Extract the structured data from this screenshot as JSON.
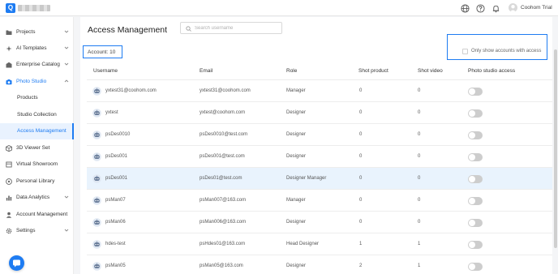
{
  "topbar": {
    "logo_letter": "Q",
    "user_name": "Coohom Trial",
    "icons": [
      "globe-icon",
      "help-icon",
      "bell-icon",
      "avatar"
    ]
  },
  "sidebar": {
    "items": [
      {
        "label": "Projects",
        "icon": "folder-icon",
        "chevron": true
      },
      {
        "label": "AI Templates",
        "icon": "sparkle-icon",
        "chevron": true
      },
      {
        "label": "Enterprise Catalog",
        "icon": "catalog-icon",
        "chevron": true
      },
      {
        "label": "Photo Studio",
        "icon": "camera-icon",
        "chevron": true,
        "expanded": true
      },
      {
        "label": "Products",
        "sub": true
      },
      {
        "label": "Studio Collection",
        "sub": true
      },
      {
        "label": "Access Management",
        "sub": true,
        "active": true
      },
      {
        "label": "3D Viewer Set",
        "icon": "cube-icon"
      },
      {
        "label": "Virtual Showroom",
        "icon": "showroom-icon"
      },
      {
        "label": "Personal Library",
        "icon": "library-icon"
      },
      {
        "label": "Data Analytics",
        "icon": "chart-icon",
        "chevron": true
      },
      {
        "label": "Account Management",
        "icon": "user-icon"
      },
      {
        "label": "Settings",
        "icon": "gear-icon",
        "chevron": true
      }
    ]
  },
  "main": {
    "title": "Access Management",
    "search_placeholder": "Search username",
    "account_count": "Account: 10",
    "filter_label": "Only show accounts with access",
    "columns": [
      "Username",
      "Email",
      "Role",
      "Shot product",
      "Shot video",
      "Photo studio access"
    ],
    "rows": [
      {
        "username": "yxtest31@coohom.com",
        "email": "yxtest31@coohom.com",
        "role": "Manager",
        "shot_product": "0",
        "shot_video": "0",
        "access": false
      },
      {
        "username": "yxtest",
        "email": "yxtest@coohom.com",
        "role": "Designer",
        "shot_product": "0",
        "shot_video": "0",
        "access": false
      },
      {
        "username": "psDes0010",
        "email": "psDes0010@test.com",
        "role": "Designer",
        "shot_product": "0",
        "shot_video": "0",
        "access": false
      },
      {
        "username": "psDes001",
        "email": "psDes001@test.com",
        "role": "Designer",
        "shot_product": "0",
        "shot_video": "0",
        "access": false
      },
      {
        "username": "psDes001",
        "email": "psDes01@test.com",
        "role": "Designer Manager",
        "shot_product": "0",
        "shot_video": "0",
        "access": false,
        "highlighted": true
      },
      {
        "username": "psMan07",
        "email": "psMan007@163.com",
        "role": "Manager",
        "shot_product": "0",
        "shot_video": "0",
        "access": false
      },
      {
        "username": "psMan06",
        "email": "psMan006@163.com",
        "role": "Designer",
        "shot_product": "0",
        "shot_video": "0",
        "access": false
      },
      {
        "username": "hdes-test",
        "email": "psHdes01@163.com",
        "role": "Head Designer",
        "shot_product": "1",
        "shot_video": "1",
        "access": false
      },
      {
        "username": "psMan05",
        "email": "psMan05@163.com",
        "role": "Designer",
        "shot_product": "2",
        "shot_video": "1",
        "access": false
      }
    ]
  },
  "colors": {
    "accent": "#1e7cf2",
    "active_bg": "#e9f2fe",
    "row_highlight": "#e9f3fd",
    "toggle_off": "#cdcdcd"
  }
}
